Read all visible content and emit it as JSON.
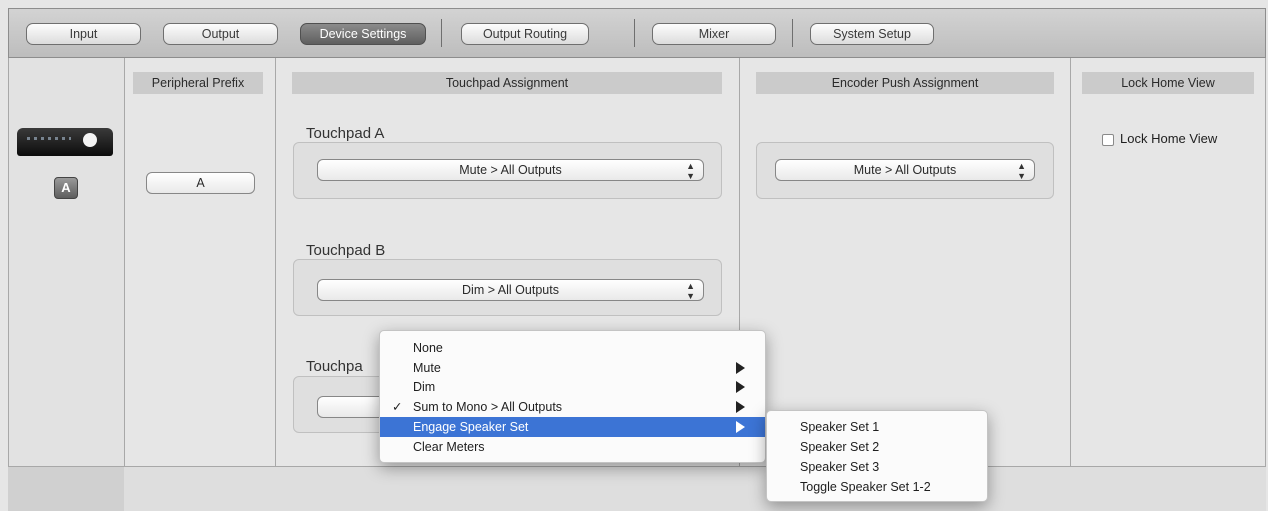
{
  "tabs": [
    {
      "label": "Input",
      "active": false
    },
    {
      "label": "Output",
      "active": false
    },
    {
      "label": "Device Settings",
      "active": true
    },
    {
      "label": "Output Routing",
      "active": false
    },
    {
      "label": "Mixer",
      "active": false
    },
    {
      "label": "System Setup",
      "active": false
    }
  ],
  "device": {
    "badge": "A"
  },
  "peripheral_prefix": {
    "header": "Peripheral Prefix",
    "value": "A"
  },
  "touchpad_assignment": {
    "header": "Touchpad Assignment",
    "touchpad_a": {
      "label": "Touchpad A",
      "value": "Mute > All Outputs"
    },
    "touchpad_b": {
      "label": "Touchpad B",
      "value": "Dim > All Outputs"
    },
    "touchpad_c": {
      "label": "Touchpa",
      "value": ""
    }
  },
  "encoder_push": {
    "header": "Encoder Push Assignment",
    "value": "Mute > All Outputs"
  },
  "lock_home_view": {
    "header": "Lock Home View",
    "checkbox_label": "Lock Home View",
    "checked": false
  },
  "context_menu": {
    "items": [
      {
        "label": "None",
        "submenu": false,
        "checked": false,
        "highlighted": false
      },
      {
        "label": "Mute",
        "submenu": true,
        "checked": false,
        "highlighted": false
      },
      {
        "label": "Dim",
        "submenu": true,
        "checked": false,
        "highlighted": false
      },
      {
        "label": "Sum to Mono > All Outputs",
        "submenu": true,
        "checked": true,
        "highlighted": false
      },
      {
        "label": "Engage Speaker Set",
        "submenu": true,
        "checked": false,
        "highlighted": true
      },
      {
        "label": "Clear Meters",
        "submenu": false,
        "checked": false,
        "highlighted": false
      }
    ],
    "check_glyph": "✓",
    "highlight_color": "#3c74d5"
  },
  "submenu": {
    "items": [
      "Speaker Set 1",
      "Speaker Set 2",
      "Speaker Set 3",
      "Toggle Speaker Set 1-2"
    ]
  }
}
